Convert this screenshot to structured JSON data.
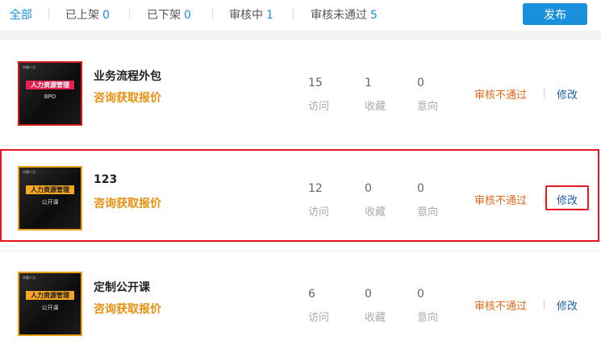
{
  "tabs": [
    {
      "label": "全部",
      "count": ""
    },
    {
      "label": "已上架",
      "count": "0"
    },
    {
      "label": "已下架",
      "count": "0"
    },
    {
      "label": "审核中",
      "count": "1"
    },
    {
      "label": "审核未通过",
      "count": "5"
    }
  ],
  "publish_label": "发布",
  "stat_labels": {
    "visits": "访问",
    "favorites": "收藏",
    "intent": "意向"
  },
  "items": [
    {
      "title": "业务流程外包",
      "quote": "咨询获取报价",
      "thumb": {
        "tiny": "中建人力",
        "banner": "人力资源管理",
        "sub": "BPO"
      },
      "visits": "15",
      "favorites": "1",
      "intent": "0",
      "status": "审核不通过",
      "edit": "修改"
    },
    {
      "title": "123",
      "quote": "咨询获取报价",
      "thumb": {
        "tiny": "中建人力",
        "banner": "人力资源管理",
        "sub": "公开课"
      },
      "visits": "12",
      "favorites": "0",
      "intent": "0",
      "status": "审核不通过",
      "edit": "修改"
    },
    {
      "title": "定制公开课",
      "quote": "咨询获取报价",
      "thumb": {
        "tiny": "中建人力",
        "banner": "人力资源管理",
        "sub": "公开课"
      },
      "visits": "6",
      "favorites": "0",
      "intent": "0",
      "status": "审核不通过",
      "edit": "修改"
    }
  ]
}
